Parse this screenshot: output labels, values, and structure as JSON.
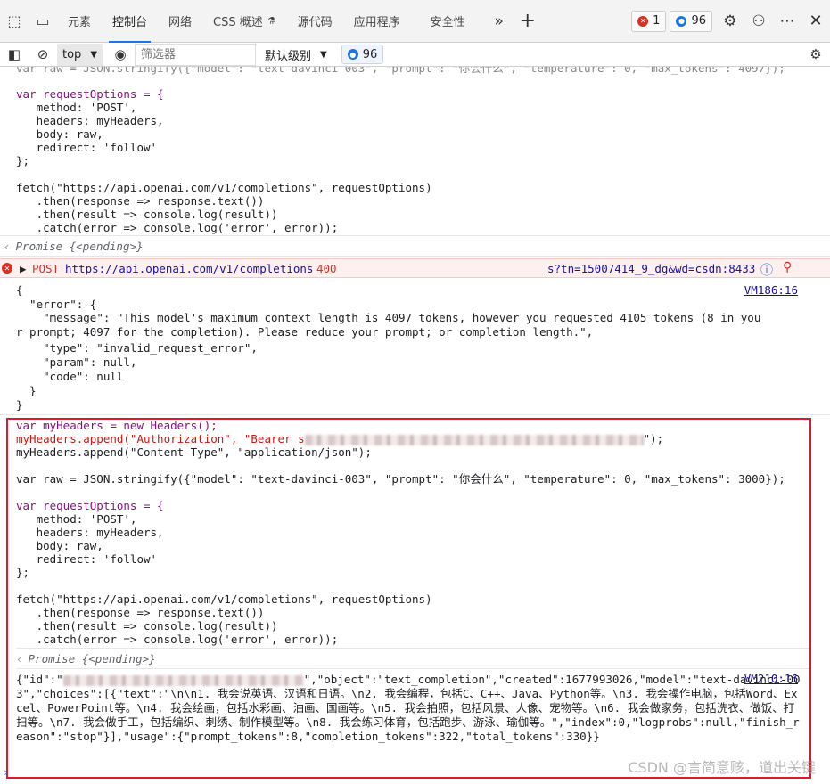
{
  "tabs": [
    {
      "label": "元素"
    },
    {
      "label": "控制台"
    },
    {
      "label": "网络"
    },
    {
      "label": "CSS 概述"
    },
    {
      "label": "源代码"
    },
    {
      "label": "应用程序"
    },
    {
      "label": "安全性"
    }
  ],
  "badges": {
    "errors": "1",
    "messages": "96"
  },
  "toolbar": {
    "context": "top",
    "filter_placeholder": "筛选器",
    "level": "默认级别",
    "messages": "96"
  },
  "code1": {
    "top_fragment": "var raw = JSON.stringify({\"model\": \"text-davinci-003\", \"prompt\": \"你会什么\", \"temperature\": 0, \"max_tokens\": 4097});",
    "l1": "var requestOptions = {",
    "l2": "   method: 'POST',",
    "l3": "   headers: myHeaders,",
    "l4": "   body: raw,",
    "l5": "   redirect: 'follow'",
    "l6": "};",
    "l7": "fetch(\"https://api.openai.com/v1/completions\", requestOptions)",
    "l8": "   .then(response => response.text())",
    "l9": "   .then(result => console.log(result))",
    "l10": "   .catch(error => console.log('error', error));"
  },
  "promise": "Promise {<pending>}",
  "error": {
    "method": "POST",
    "url": "https://api.openai.com/v1/completions",
    "status": "400",
    "source": "s?tn=15007414_9_dg&wd=csdn:8433"
  },
  "response1": {
    "vm": "VM186:16",
    "l1": "{",
    "l2": "  \"error\": {",
    "l3": "    \"message\": \"This model's maximum context length is 4097 tokens, however you requested 4105 tokens (8 in your prompt; 4097 for the completion). Please reduce your prompt; or completion length.\",",
    "l4": "    \"type\": \"invalid_request_error\",",
    "l5": "    \"param\": null,",
    "l6": "    \"code\": null",
    "l7": "  }",
    "l8": "}"
  },
  "code2": {
    "l1": "var myHeaders = new Headers();",
    "l2a": "myHeaders.append(\"Authorization\", \"Bearer s",
    "l2b": "\");",
    "l3": "myHeaders.append(\"Content-Type\", \"application/json\");",
    "l4": "var raw = JSON.stringify({\"model\": \"text-davinci-003\", \"prompt\": \"你会什么\", \"temperature\": 0, \"max_tokens\": 3000});",
    "l5": "var requestOptions = {",
    "l6": "   method: 'POST',",
    "l7": "   headers: myHeaders,",
    "l8": "   body: raw,",
    "l9": "   redirect: 'follow'",
    "l10": "};",
    "l11": "fetch(\"https://api.openai.com/v1/completions\", requestOptions)",
    "l12": "   .then(response => response.text())",
    "l13": "   .then(result => console.log(result))",
    "l14": "   .catch(error => console.log('error', error));"
  },
  "response2": {
    "vm": "VM210:16",
    "prefix": "{\"id\":\"",
    "text": "\",\"object\":\"text_completion\",\"created\":1677993026,\"model\":\"text-davinci-003\",\"choices\":[{\"text\":\"\\n\\n1. 我会说英语、汉语和日语。\\n2. 我会编程，包括C、C++、Java、Python等。\\n3. 我会操作电脑，包括Word、Excel、PowerPoint等。\\n4. 我会绘画，包括水彩画、油画、国画等。\\n5. 我会拍照，包括风景、人像、宠物等。\\n6. 我会做家务，包括洗衣、做饭、打扫等。\\n7. 我会做手工，包括编织、刺绣、制作模型等。\\n8. 我会练习体育，包括跑步、游泳、瑜伽等。\",\"index\":0,\"logprobs\":null,\"finish_reason\":\"stop\"}],\"usage\":{\"prompt_tokens\":8,\"completion_tokens\":322,\"total_tokens\":330}}"
  },
  "watermark": "CSDN @言简意赅，道出关键"
}
